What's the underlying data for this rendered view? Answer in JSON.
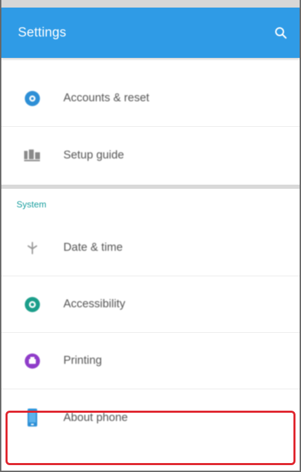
{
  "appbar": {
    "title": "Settings",
    "search_icon": "search-icon",
    "color": "#2f9be6"
  },
  "top_items": [
    {
      "label": "Accounts & reset",
      "icon": "accounts-gear-icon",
      "icon_color": "#2d8fd6"
    },
    {
      "label": "Setup guide",
      "icon": "setup-guide-icon",
      "icon_color": "#8a8a8a"
    }
  ],
  "section": {
    "header": "System",
    "header_color": "#1ea0a0"
  },
  "system_items": [
    {
      "label": "Date & time",
      "icon": "clock-icon",
      "icon_color": "#9a9a9a"
    },
    {
      "label": "Accessibility",
      "icon": "accessibility-icon",
      "icon_color": "#1b9e8a"
    },
    {
      "label": "Printing",
      "icon": "printing-icon",
      "icon_color": "#8f3cc9"
    },
    {
      "label": "About phone",
      "icon": "phone-icon",
      "icon_color": "#2d8fd6"
    }
  ],
  "highlight": {
    "target": "About phone",
    "color": "#e0262f"
  }
}
